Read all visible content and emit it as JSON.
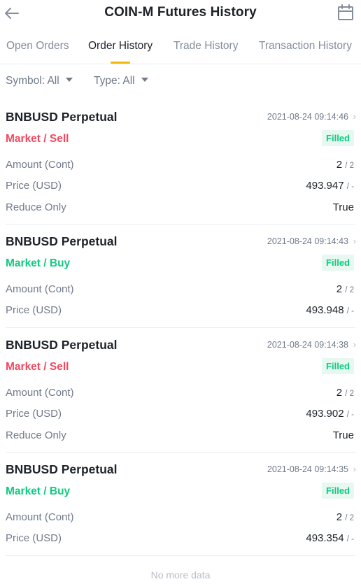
{
  "header": {
    "title": "COIN-M Futures History",
    "back_icon": "arrow-left-icon",
    "calendar_icon": "calendar-icon"
  },
  "tabs": [
    {
      "label": "Open Orders",
      "active": false
    },
    {
      "label": "Order History",
      "active": true
    },
    {
      "label": "Trade History",
      "active": false
    },
    {
      "label": "Transaction History",
      "active": false
    }
  ],
  "filters": {
    "symbol": "Symbol: All",
    "type": "Type: All"
  },
  "colors": {
    "sell": "#f6465d",
    "buy": "#0ecb81",
    "accent": "#f0b90b"
  },
  "orders": [
    {
      "symbol": "BNBUSD Perpetual",
      "time": "2021-08-24 09:14:46",
      "side": "Market / Sell",
      "status": "Filled",
      "amount_label": "Amount (Cont)",
      "amount_filled": "2",
      "amount_total": "/ 2",
      "price_label": "Price (USD)",
      "price_avg": "493.947",
      "price_order": "/ -",
      "reduce_label": "Reduce Only",
      "reduce_value": "True"
    },
    {
      "symbol": "BNBUSD Perpetual",
      "time": "2021-08-24 09:14:43",
      "side": "Market / Buy",
      "status": "Filled",
      "amount_label": "Amount (Cont)",
      "amount_filled": "2",
      "amount_total": "/ 2",
      "price_label": "Price (USD)",
      "price_avg": "493.948",
      "price_order": "/ -"
    },
    {
      "symbol": "BNBUSD Perpetual",
      "time": "2021-08-24 09:14:38",
      "side": "Market / Sell",
      "status": "Filled",
      "amount_label": "Amount (Cont)",
      "amount_filled": "2",
      "amount_total": "/ 2",
      "price_label": "Price (USD)",
      "price_avg": "493.902",
      "price_order": "/ -",
      "reduce_label": "Reduce Only",
      "reduce_value": "True"
    },
    {
      "symbol": "BNBUSD Perpetual",
      "time": "2021-08-24 09:14:35",
      "side": "Market / Buy",
      "status": "Filled",
      "amount_label": "Amount (Cont)",
      "amount_filled": "2",
      "amount_total": "/ 2",
      "price_label": "Price (USD)",
      "price_avg": "493.354",
      "price_order": "/ -"
    }
  ],
  "footer": {
    "no_more": "No more data"
  }
}
